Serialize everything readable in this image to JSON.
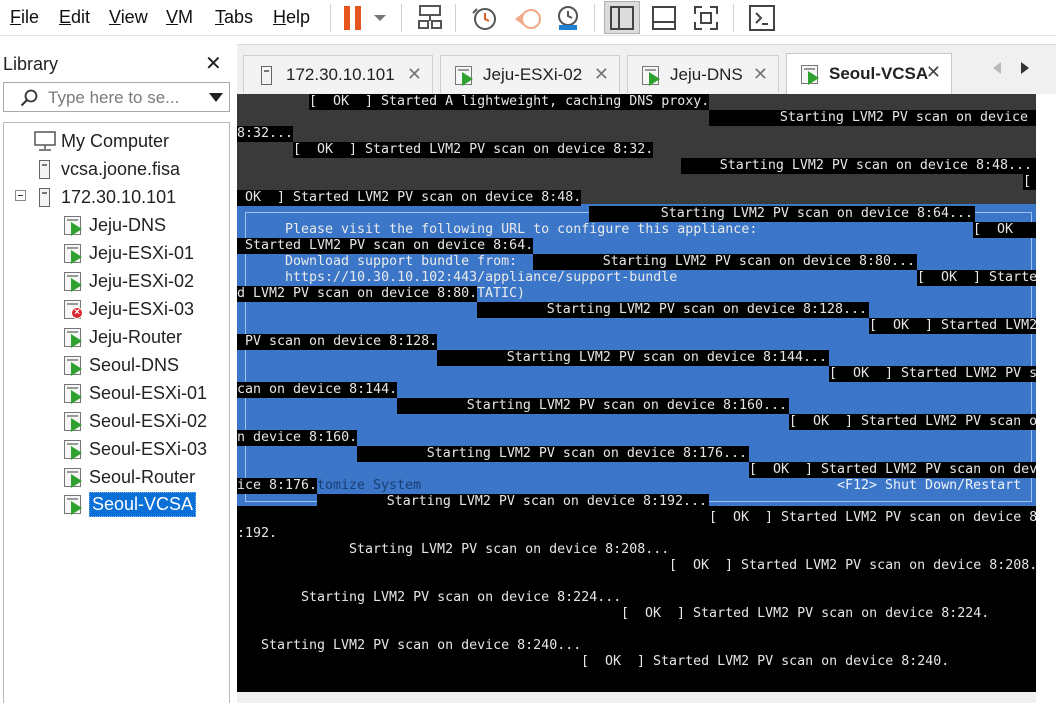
{
  "menubar": {
    "items": [
      {
        "key": "F",
        "rest": "ile"
      },
      {
        "key": "E",
        "rest": "dit"
      },
      {
        "key": "V",
        "rest": "iew"
      },
      {
        "key": "V",
        "rest": "M"
      },
      {
        "key": "T",
        "rest": "abs"
      },
      {
        "key": "H",
        "rest": "elp"
      }
    ]
  },
  "toolbar": {
    "pause_color": "#e8541d",
    "snapshot_accent": "#e15a2a"
  },
  "library": {
    "title": "Library",
    "close_glyph": "✕",
    "search_placeholder": "Type here to se...",
    "items": [
      {
        "label": "My Computer",
        "icon": "computer-icon"
      },
      {
        "label": "vcsa.joone.fisa",
        "icon": "host-icon"
      },
      {
        "label": "172.30.10.101",
        "icon": "host-icon"
      },
      {
        "label": "Jeju-DNS",
        "icon": "vm-running-icon"
      },
      {
        "label": "Jeju-ESXi-01",
        "icon": "vm-running-icon"
      },
      {
        "label": "Jeju-ESXi-02",
        "icon": "vm-running-icon"
      },
      {
        "label": "Jeju-ESXi-03",
        "icon": "vm-error-icon"
      },
      {
        "label": "Jeju-Router",
        "icon": "vm-running-icon"
      },
      {
        "label": "Seoul-DNS",
        "icon": "vm-running-icon"
      },
      {
        "label": "Seoul-ESXi-01",
        "icon": "vm-running-icon"
      },
      {
        "label": "Seoul-ESXi-02",
        "icon": "vm-running-icon"
      },
      {
        "label": "Seoul-ESXi-03",
        "icon": "vm-running-icon"
      },
      {
        "label": "Seoul-Router",
        "icon": "vm-running-icon"
      },
      {
        "label": "Seoul-VCSA",
        "icon": "vm-running-icon",
        "selected": true
      }
    ]
  },
  "tabs": [
    {
      "label": "172.30.10.101",
      "icon": "host-icon"
    },
    {
      "label": "Jeju-ESXi-02",
      "icon": "vm-running-icon"
    },
    {
      "label": "Jeju-DNS",
      "icon": "vm-running-icon"
    },
    {
      "label": "Seoul-VCSA",
      "icon": "vm-running-icon",
      "active": true
    }
  ],
  "console": {
    "lines": [
      "[  OK  ] Started A lightweight, caching DNS proxy.",
      "Starting LVM2 PV scan on device",
      "8:32...",
      "[  OK  ] Started LVM2 PV scan on device 8:32.",
      "Starting LVM2 PV scan on device 8:48...",
      "[",
      " OK  ] Started LVM2 PV scan on device 8:48.",
      "Starting LVM2 PV scan on device 8:64...",
      "Please visit the following URL to configure this appliance:",
      "[  OK",
      " Started LVM2 PV scan on device 8:64.",
      "Download support bundle from:",
      "Starting LVM2 PV scan on device 8:80...",
      "https://10.30.10.102:443/appliance/support-bundle",
      "[  OK  ] Starte",
      "d LVM2 PV scan on device 8:80.",
      "TATIC)",
      "Starting LVM2 PV scan on device 8:128...",
      "[  OK  ] Started LVM2",
      " PV scan on device 8:128.",
      "Starting LVM2 PV scan on device 8:144...",
      "[  OK  ] Started LVM2 PV s",
      "can on device 8:144.",
      "Starting LVM2 PV scan on device 8:160...",
      "[  OK  ] Started LVM2 PV scan o",
      "n device 8:160.",
      "Starting LVM2 PV scan on device 8:176...",
      "[  OK  ] Started LVM2 PV scan on dev",
      "ice 8:176.",
      "tomize System",
      "<F12> Shut Down/Restart",
      "Starting LVM2 PV scan on device 8:192...",
      "[  OK  ] Started LVM2 PV scan on device 8",
      ":192.",
      "Starting LVM2 PV scan on device 8:208...",
      "[  OK  ] Started LVM2 PV scan on device 8:208.",
      "Starting LVM2 PV scan on device 8:224...",
      "[  OK  ] Started LVM2 PV scan on device 8:224.",
      "Starting LVM2 PV scan on device 8:240...",
      "[  OK  ] Started LVM2 PV scan on device 8:240."
    ],
    "dcui_blue": "#3b76c8",
    "dcui_grey": "#3a3a3a"
  }
}
